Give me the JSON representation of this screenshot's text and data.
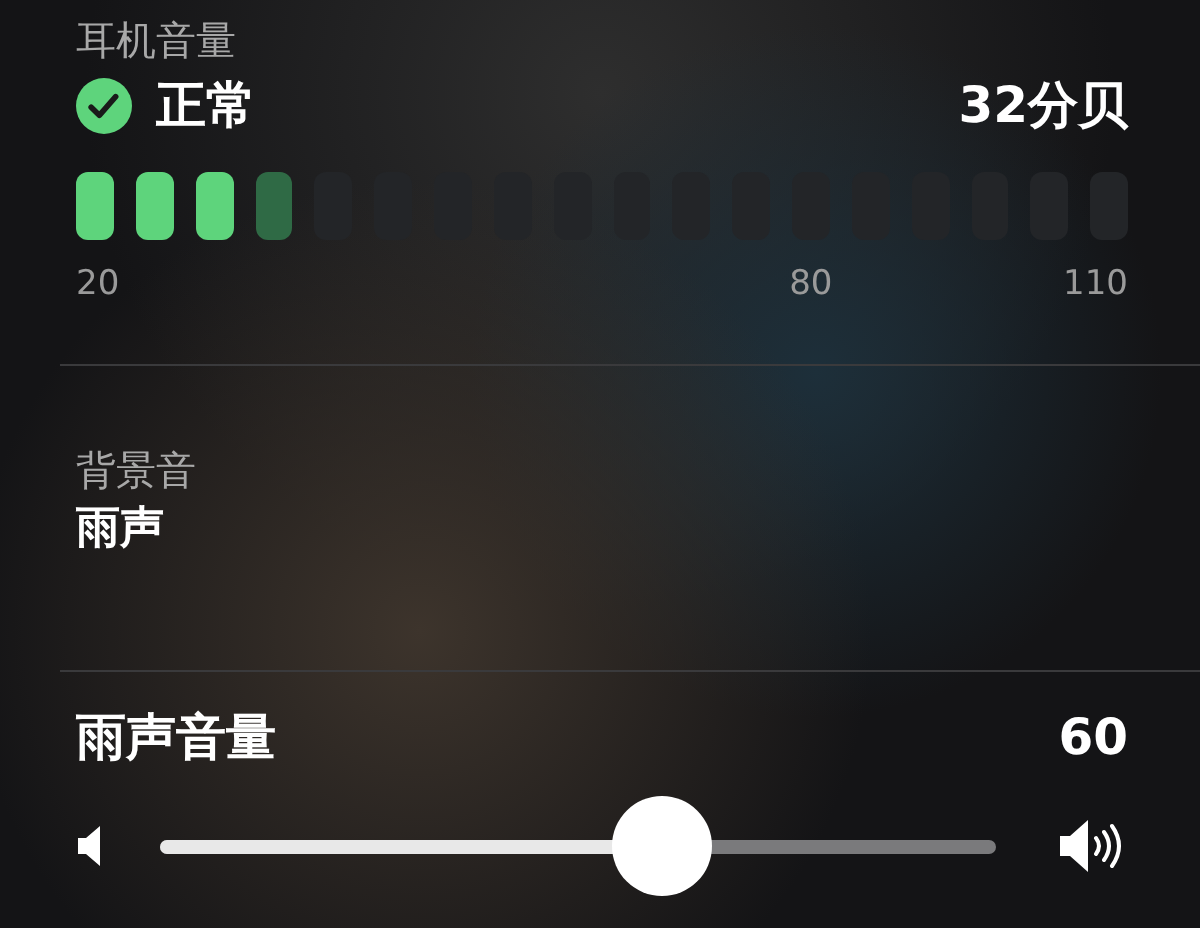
{
  "headphone_level": {
    "title": "耳机音量",
    "status": {
      "label": "正常",
      "ok": true
    },
    "reading": "32分贝",
    "level": 0.2,
    "scale": [
      "20",
      "80",
      "110"
    ]
  },
  "background_sound": {
    "title": "背景音",
    "value": "雨声"
  },
  "volume": {
    "label": "雨声音量",
    "reading": "60",
    "level": 0.6
  }
}
